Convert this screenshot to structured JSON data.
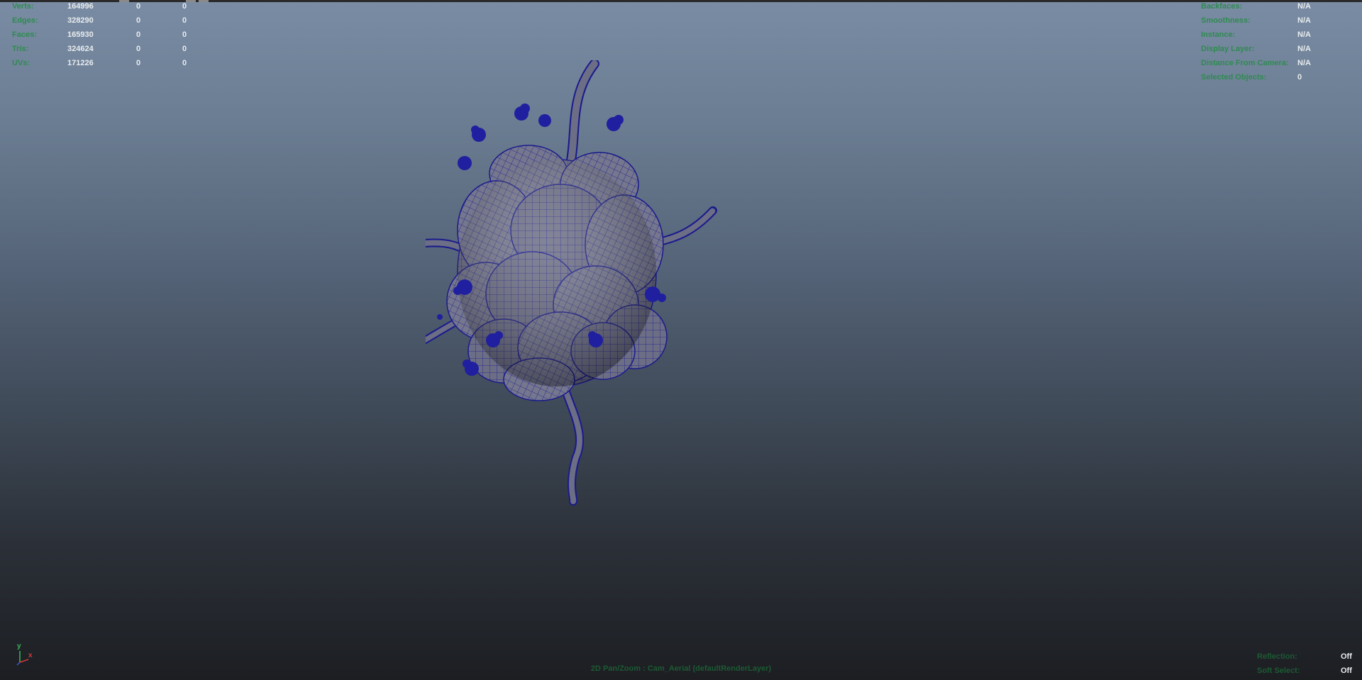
{
  "stats": [
    {
      "label": "Verts:",
      "v1": "164996",
      "v2": "0",
      "v3": "0"
    },
    {
      "label": "Edges:",
      "v1": "328290",
      "v2": "0",
      "v3": "0"
    },
    {
      "label": "Faces:",
      "v1": "165930",
      "v2": "0",
      "v3": "0"
    },
    {
      "label": "Tris:",
      "v1": "324624",
      "v2": "0",
      "v3": "0"
    },
    {
      "label": "UVs:",
      "v1": "171226",
      "v2": "0",
      "v3": "0"
    }
  ],
  "info": [
    {
      "label": "Backfaces:",
      "value": "N/A"
    },
    {
      "label": "Smoothness:",
      "value": "N/A"
    },
    {
      "label": "Instance:",
      "value": "N/A"
    },
    {
      "label": "Display Layer:",
      "value": "N/A"
    },
    {
      "label": "Distance From Camera:",
      "value": "N/A"
    },
    {
      "label": "Selected Objects:",
      "value": "0"
    }
  ],
  "bottom_right": [
    {
      "label": "Reflection:",
      "value": "Off"
    },
    {
      "label": "Soft Select:",
      "value": "Off"
    }
  ],
  "camera_label": "2D Pan/Zoom : Cam_Aerial (defaultRenderLayer)",
  "axis": {
    "y": "y",
    "x": "x"
  },
  "colors": {
    "hud_label": "#2f8a52",
    "hud_value": "#e8ecef",
    "wireframe": "#1a1a8c",
    "mesh_fill": "#6c6e86"
  }
}
